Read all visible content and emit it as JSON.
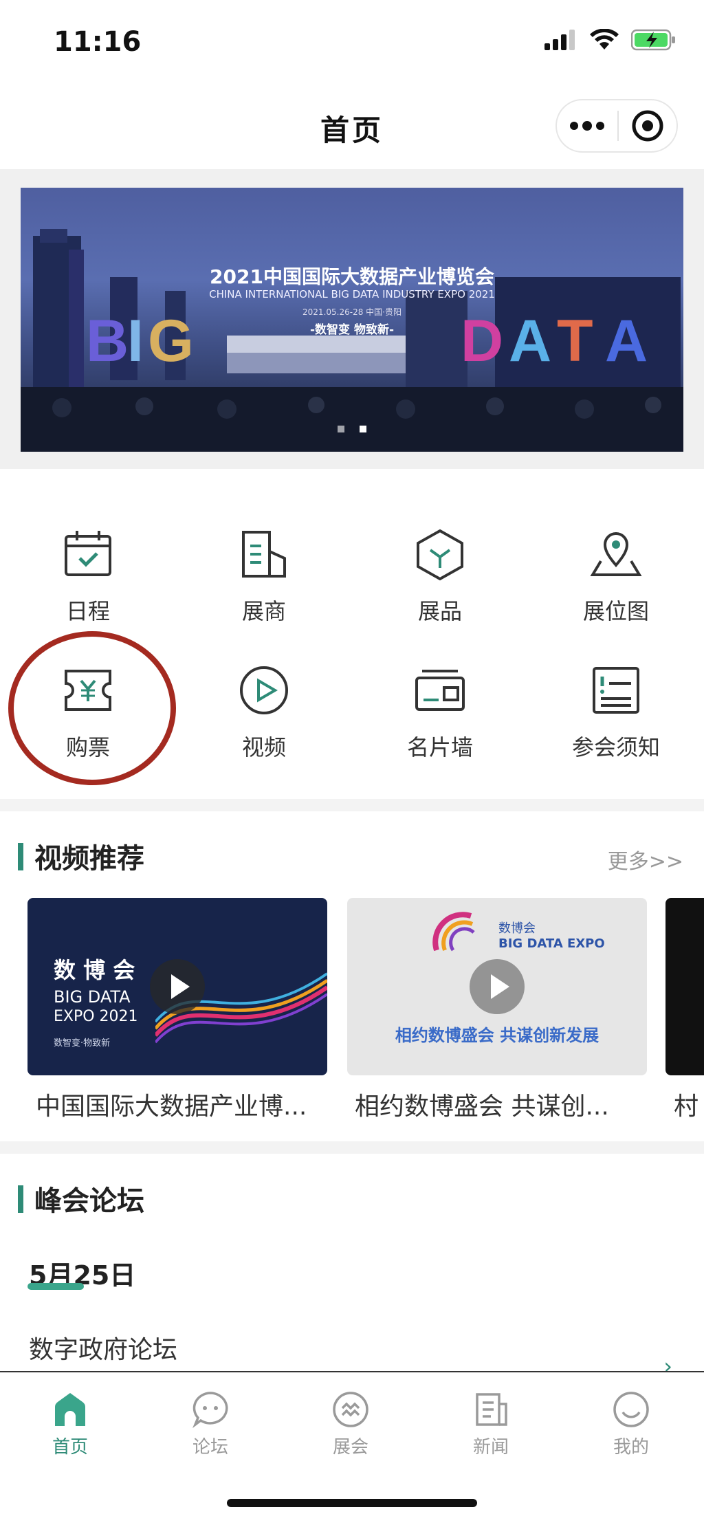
{
  "status_bar": {
    "time": "11:16"
  },
  "nav": {
    "title": "首页"
  },
  "banner": {
    "title": "2021中国国际大数据产业博览会",
    "subtitle": "CHINA INTERNATIONAL BIG DATA INDUSTRY EXPO 2021",
    "date": "2021.05.26-28  中国·贵阳",
    "slogan": "-数智变 物致新-",
    "slide_count": 2,
    "active_slide": 2
  },
  "menu": {
    "items": [
      {
        "label": "日程",
        "icon": "calendar-check-icon"
      },
      {
        "label": "展商",
        "icon": "building-doc-icon"
      },
      {
        "label": "展品",
        "icon": "cube-icon"
      },
      {
        "label": "展位图",
        "icon": "map-pin-icon"
      },
      {
        "label": "购票",
        "icon": "ticket-yen-icon"
      },
      {
        "label": "视频",
        "icon": "play-circle-icon"
      },
      {
        "label": "名片墙",
        "icon": "business-card-icon"
      },
      {
        "label": "参会须知",
        "icon": "notice-list-icon"
      }
    ]
  },
  "video_section": {
    "title": "视频推荐",
    "more": "更多>>",
    "videos": [
      {
        "caption": "中国国际大数据产业博...",
        "thumb_text": "数 博 会",
        "thumb_sub": "BIG DATA",
        "thumb_sub2": "EXPO 2021",
        "thumb_tag": "数智变·物致新"
      },
      {
        "caption": "相约数博盛会 共谋创...",
        "thumb_text": "相约数博盛会  共谋创新发展",
        "thumb_sub": "数博会",
        "thumb_sub2": "BIG DATA EXPO"
      },
      {
        "caption": "村"
      }
    ]
  },
  "forum_section": {
    "title": "峰会论坛",
    "date": "5月25日",
    "first_item": "数字政府论坛"
  },
  "tab_bar": {
    "tabs": [
      {
        "label": "首页",
        "icon": "home-icon",
        "active": true
      },
      {
        "label": "论坛",
        "icon": "chat-bubble-icon",
        "active": false
      },
      {
        "label": "展会",
        "icon": "expo-icon",
        "active": false
      },
      {
        "label": "新闻",
        "icon": "news-icon",
        "active": false
      },
      {
        "label": "我的",
        "icon": "smile-icon",
        "active": false
      }
    ]
  },
  "colors": {
    "accent": "#2e8b77",
    "highlight_circle": "#a42a20",
    "inactive": "#9a9a9a"
  }
}
